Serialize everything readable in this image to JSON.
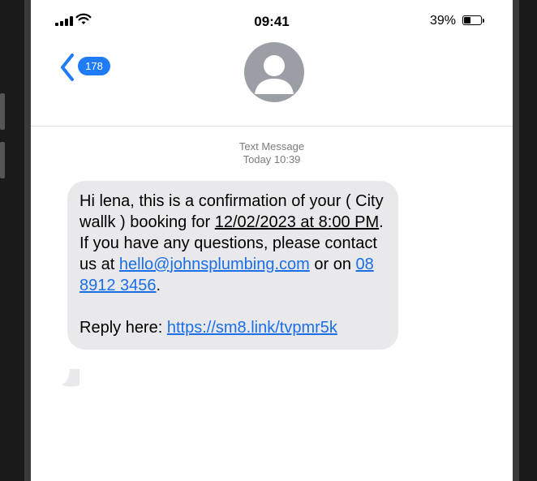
{
  "status_bar": {
    "time": "09:41",
    "battery_percent": "39%",
    "battery_level": 0.39
  },
  "nav": {
    "back_count": "178",
    "avatar_icon": "person-silhouette-icon"
  },
  "thread": {
    "meta_type": "Text Message",
    "meta_time": "Today 10:39"
  },
  "message": {
    "greeting": "Hi ",
    "name": "lena",
    "text1": ", this is a confirmation of your ",
    "service": "( City wallk )",
    "text2": " booking for ",
    "date_time": "12/02/2023 at 8:00 PM",
    "text3": ". If you have any questions, please contact us at ",
    "email": "hello@johnsplumbing.com",
    "text4": " or on ",
    "phone": "08 8912 3456",
    "text5": ".",
    "reply_prefix": "Reply here: ",
    "reply_link": "https://sm8.link/tvpmr5k"
  },
  "colors": {
    "link": "#1a6fe8",
    "badge": "#1f7cf6",
    "bubble": "#e9e9eb",
    "meta_text": "#7b7b80"
  }
}
